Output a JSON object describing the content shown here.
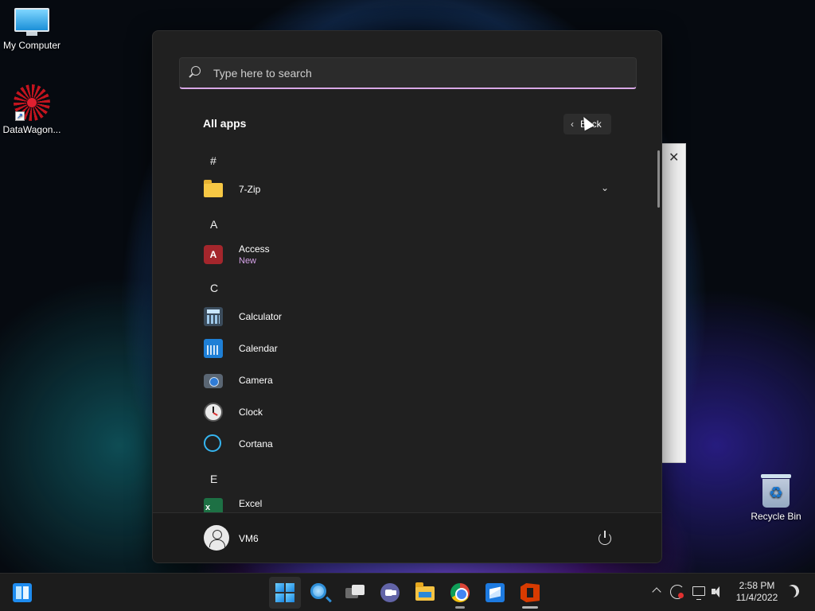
{
  "desktop": {
    "icons": [
      {
        "label": "My Computer"
      },
      {
        "label": "DataWagon..."
      },
      {
        "label": "Recycle Bin"
      }
    ]
  },
  "start_menu": {
    "search_placeholder": "Type here to search",
    "title": "All apps",
    "back_label": "Back",
    "groups": [
      {
        "letter": "#",
        "apps": [
          {
            "name": "7-Zip",
            "icon": "folder-icon",
            "expandable": true
          }
        ]
      },
      {
        "letter": "A",
        "apps": [
          {
            "name": "Access",
            "subtitle": "New",
            "icon": "access-icon"
          }
        ]
      },
      {
        "letter": "C",
        "apps": [
          {
            "name": "Calculator",
            "icon": "calculator-icon"
          },
          {
            "name": "Calendar",
            "icon": "calendar-icon"
          },
          {
            "name": "Camera",
            "icon": "camera-icon"
          },
          {
            "name": "Clock",
            "icon": "clock-icon"
          },
          {
            "name": "Cortana",
            "icon": "cortana-icon"
          }
        ]
      },
      {
        "letter": "E",
        "apps": [
          {
            "name": "Excel",
            "icon": "excel-icon"
          }
        ]
      }
    ],
    "user": {
      "name": "VM6"
    }
  },
  "taskbar": {
    "apps": [
      "widgets-icon",
      "start-icon",
      "search-icon",
      "task-view-icon",
      "teams-chat-icon",
      "file-explorer-icon",
      "chrome-icon",
      "box-app-icon",
      "office-icon"
    ],
    "clock": {
      "time": "2:58 PM",
      "date": "11/4/2022"
    }
  },
  "colors": {
    "accent_underline": "#d8a8e6",
    "new_badge": "#d6a3e8",
    "menu_bg": "#202020",
    "taskbar_bg": "#1c1c1c"
  }
}
